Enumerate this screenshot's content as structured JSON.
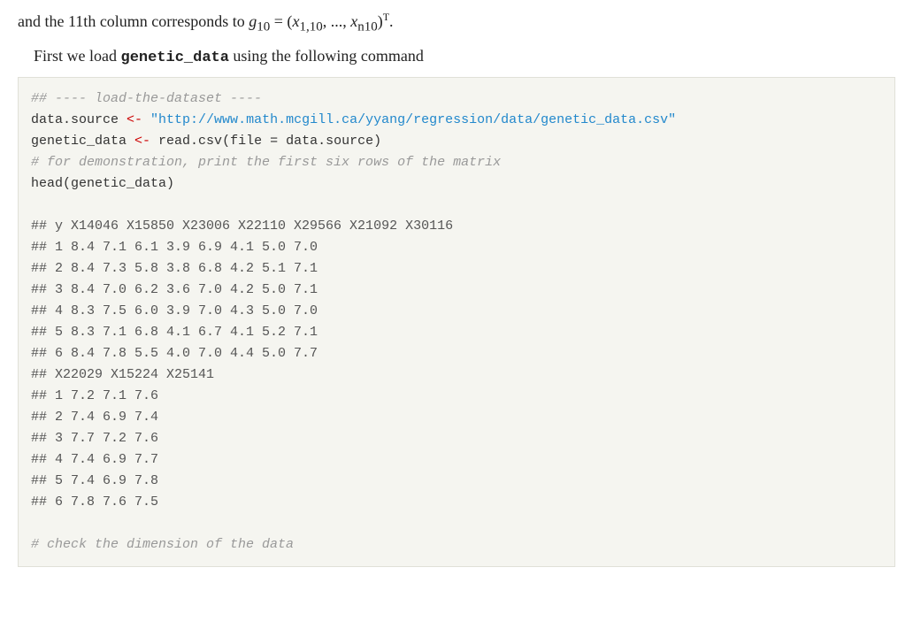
{
  "intro": {
    "line1": "and the 11th column corresponds to g",
    "subscript": "10",
    "equals": " = (x",
    "sub2": "1,10",
    "ellipsis": ", ..., x",
    "sub3": "n10",
    "superscript": "T",
    "line2_prefix": "First we load ",
    "code_word": "genetic_data",
    "line2_suffix": " using the following command"
  },
  "code": {
    "comment1": "## ---- load-the-dataset ----",
    "line1_var": "data.source",
    "line1_assign": " <- ",
    "line1_url": "\"http://www.math.mcgill.ca/yyang/regression/data/genetic_data.csv\"",
    "line2_var": "genetic_data",
    "line2_assign": " <- ",
    "line2_fn": "read.csv",
    "line2_args": "(file = data.source)",
    "comment2": "# for demonstration, print the first six rows of the matrix",
    "line3": "head(genetic_data)",
    "blank1": "",
    "output_header1": "##       y X14046 X15850 X23006 X22110 X29566 X21092 X30116",
    "output_rows1": [
      "## 1 8.4    7.1    6.1    3.9    6.9    4.1    5.0    7.0",
      "## 2 8.4    7.3    5.8    3.8    6.8    4.2    5.1    7.1",
      "## 3 8.4    7.0    6.2    3.6    7.0    4.2    5.0    7.1",
      "## 4 8.3    7.5    6.0    3.9    7.0    4.3    5.0    7.0",
      "## 5 8.3    7.1    6.8    4.1    6.7    4.1    5.2    7.1",
      "## 6 8.4    7.8    5.5    4.0    7.0    4.4    5.0    7.7"
    ],
    "output_header2": "##    X22029 X15224 X25141",
    "output_rows2": [
      "## 1    7.2    7.1    7.6",
      "## 2    7.4    6.9    7.4",
      "## 3    7.7    7.2    7.6",
      "## 4    7.4    6.9    7.7",
      "## 5    7.4    6.9    7.8",
      "## 6    7.8    7.6    7.5"
    ],
    "blank2": "",
    "comment3": "# check the dimension of the data"
  }
}
